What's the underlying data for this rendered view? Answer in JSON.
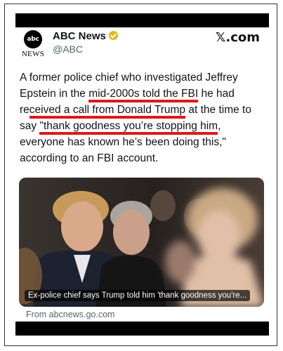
{
  "header": {
    "avatar_logo_text": "abc",
    "avatar_sub_text": "NEWS",
    "account_name": "ABC News",
    "account_handle": "@ABC",
    "site_label": "𝕏.com"
  },
  "tweet": {
    "lines": [
      [
        "A former police chief who investigated Jeffrey"
      ],
      [
        "Epstein in the ",
        "mid-2000s told the FBI",
        " he had"
      ],
      [
        "re",
        "ceived a call from Donald Trump",
        " at the time to"
      ],
      [
        "say ",
        "\"thank goodness you’re stopping him",
        ","
      ],
      [
        "everyone has known he’s been doing this,\""
      ],
      [
        "according to an FBI account."
      ]
    ]
  },
  "card": {
    "caption": "Ex-police chief says Trump told him 'thank goodness you're...",
    "source": "From abcnews.go.com"
  },
  "colors": {
    "underline": "#e01818",
    "verified_badge": "#e2b719",
    "secondary_text": "#536471"
  }
}
